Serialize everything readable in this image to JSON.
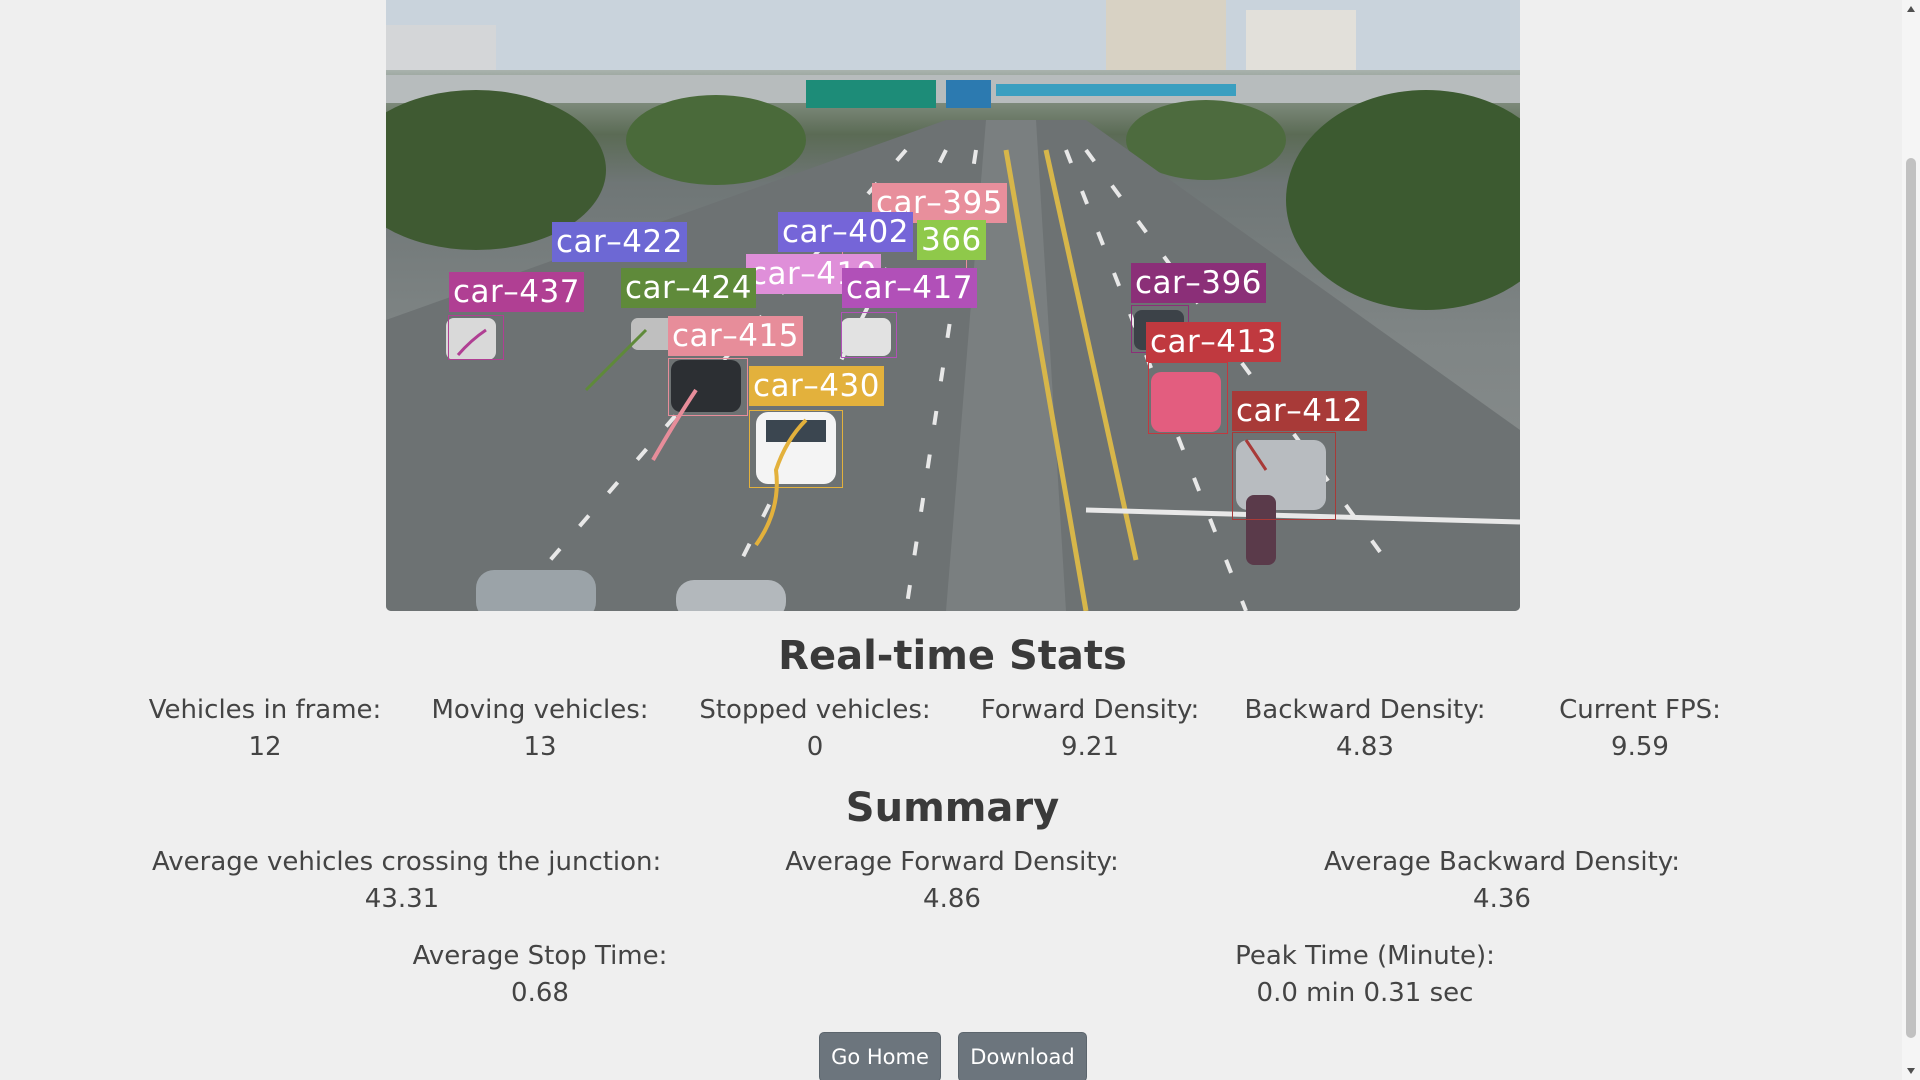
{
  "video": {
    "detections": [
      {
        "label": "car–395",
        "color": "#e88f9c"
      },
      {
        "label": "car–402",
        "color": "#7565d8"
      },
      {
        "label": "366",
        "color": "#8fc94a"
      },
      {
        "label": "car–422",
        "color": "#6d68d4"
      },
      {
        "label": "car–419",
        "color": "#df8fd9"
      },
      {
        "label": "car–417",
        "color": "#b150b8"
      },
      {
        "label": "car–424",
        "color": "#5f8a3a"
      },
      {
        "label": "car–437",
        "color": "#b03f93"
      },
      {
        "label": "car–415",
        "color": "#e78d9a"
      },
      {
        "label": "car–430",
        "color": "#e3b13c"
      },
      {
        "label": "car–396",
        "color": "#8b2f78"
      },
      {
        "label": "car–413",
        "color": "#c0393f"
      },
      {
        "label": "car–412",
        "color": "#a83a38"
      }
    ]
  },
  "realtime": {
    "title": "Real-time Stats",
    "stats": [
      {
        "label": "Vehicles in frame:",
        "value": "12"
      },
      {
        "label": "Moving vehicles:",
        "value": "13"
      },
      {
        "label": "Stopped vehicles:",
        "value": "0"
      },
      {
        "label": "Forward Density:",
        "value": "9.21"
      },
      {
        "label": "Backward Density:",
        "value": "4.83"
      },
      {
        "label": "Current FPS:",
        "value": "9.59"
      }
    ]
  },
  "summary": {
    "title": "Summary",
    "stats": [
      {
        "label": "Average vehicles crossing the junction:",
        "value": "43.31"
      },
      {
        "label": "Average Forward Density:",
        "value": "4.86"
      },
      {
        "label": "Average Backward Density:",
        "value": "4.36"
      },
      {
        "label": "Average Stop Time:",
        "value": "0.68"
      },
      {
        "label": "Peak Time (Minute):",
        "value": "0.0 min 0.31 sec"
      }
    ]
  },
  "buttons": {
    "home": "Go Home",
    "download": "Download"
  }
}
